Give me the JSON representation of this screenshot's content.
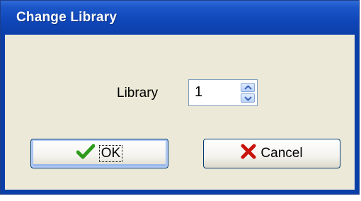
{
  "window": {
    "title": "Change Library"
  },
  "form": {
    "library_label": "Library",
    "library_value": "1"
  },
  "buttons": {
    "ok_label": "OK",
    "cancel_label": "Cancel"
  },
  "icons": {
    "ok": "checkmark-icon",
    "cancel": "x-icon",
    "spin_up": "chevron-up-icon",
    "spin_down": "chevron-down-icon"
  },
  "colors": {
    "titlebar": "#0c3fa9",
    "dialog_bg": "#ece9d8",
    "ok_icon": "#2e9a1c",
    "cancel_icon": "#c8140c"
  }
}
